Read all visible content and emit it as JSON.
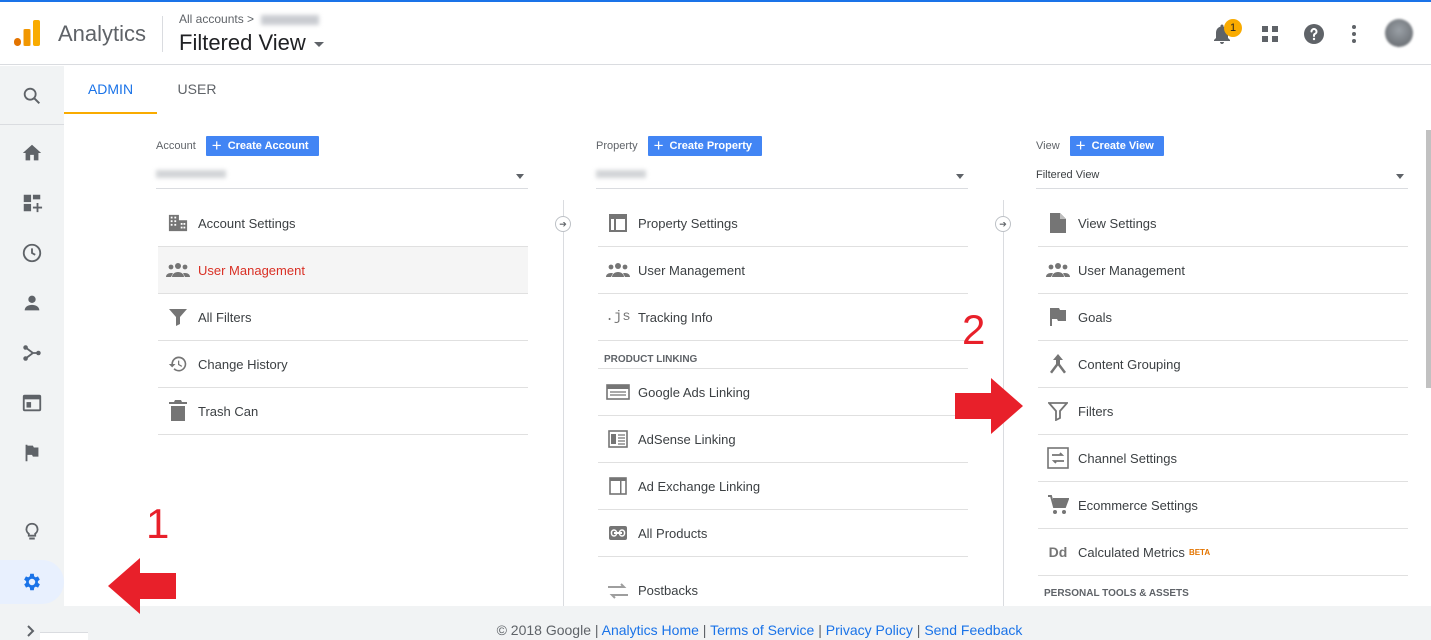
{
  "header": {
    "app_name": "Analytics",
    "breadcrumb_root": "All accounts",
    "breadcrumb_sep": ">",
    "view_title": "Filtered View",
    "notification_count": "1",
    "accent_color": "#1a73e8"
  },
  "tabs": [
    {
      "label": "ADMIN",
      "active": true
    },
    {
      "label": "USER",
      "active": false
    }
  ],
  "account": {
    "label": "Account",
    "create_label": "Create Account",
    "items": [
      {
        "label": "Account Settings",
        "icon": "building-icon"
      },
      {
        "label": "User Management",
        "icon": "people-icon",
        "highlighted": true
      },
      {
        "label": "All Filters",
        "icon": "filter-icon"
      },
      {
        "label": "Change History",
        "icon": "history-icon"
      },
      {
        "label": "Trash Can",
        "icon": "trash-icon"
      }
    ]
  },
  "property": {
    "label": "Property",
    "create_label": "Create Property",
    "items": [
      {
        "label": "Property Settings",
        "icon": "window-icon"
      },
      {
        "label": "User Management",
        "icon": "people-icon"
      },
      {
        "label": "Tracking Info",
        "icon": "js-icon",
        "glyph": ".js"
      }
    ],
    "section_title": "PRODUCT LINKING",
    "linking_items": [
      {
        "label": "Google Ads Linking",
        "icon": "ads-icon"
      },
      {
        "label": "AdSense Linking",
        "icon": "adsense-icon"
      },
      {
        "label": "Ad Exchange Linking",
        "icon": "adexchange-icon"
      },
      {
        "label": "All Products",
        "icon": "link-icon"
      },
      {
        "label": "Postbacks",
        "icon": "postbacks-icon"
      }
    ]
  },
  "view": {
    "label": "View",
    "create_label": "Create View",
    "selected": "Filtered View",
    "items": [
      {
        "label": "View Settings",
        "icon": "document-icon"
      },
      {
        "label": "User Management",
        "icon": "people-icon"
      },
      {
        "label": "Goals",
        "icon": "flag-icon"
      },
      {
        "label": "Content Grouping",
        "icon": "grouping-icon"
      },
      {
        "label": "Filters",
        "icon": "filter-icon"
      },
      {
        "label": "Channel Settings",
        "icon": "channel-icon"
      },
      {
        "label": "Ecommerce Settings",
        "icon": "cart-icon"
      },
      {
        "label": "Calculated Metrics",
        "icon": "dd-icon",
        "glyph": "Dd",
        "badge": "BETA"
      }
    ],
    "section_title": "PERSONAL TOOLS & ASSETS"
  },
  "footer": {
    "copyright": "© 2018 Google",
    "sep": "|",
    "links": [
      "Analytics Home",
      "Terms of Service",
      "Privacy Policy",
      "Send Feedback"
    ]
  },
  "annotations": {
    "one": "1",
    "two": "2",
    "arrow_color": "#e8202a"
  }
}
